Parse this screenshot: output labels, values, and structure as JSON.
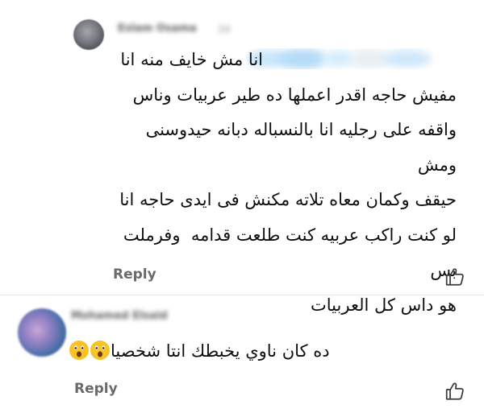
{
  "comments": [
    {
      "author": "Eslam Osama",
      "time": "2d",
      "text": "انا مش خايف منه انا\nمفيش حاجه اقدر اعملها ده طير عربيات وناس\nواقفه على رجليه انا بالنسباله دبانه حيدوسنى ومش\nحيقف وكمان معاه تلاته مكنش فى ايدى حاجه انا\nلو كنت راكب عربيه كنت طلعت قدامه  وفرملت بس\nهو داس كل العربيات",
      "reply_label": "Reply",
      "like_icon": "thumbs-up-icon"
    },
    {
      "author": "Mohamed Elsaid",
      "text": "ده كان ناوي يخبطك انتا شخصيا",
      "emojis": [
        "astonished-face-icon",
        "astonished-face-icon"
      ],
      "reply_label": "Reply",
      "like_icon": "thumbs-up-icon"
    }
  ]
}
